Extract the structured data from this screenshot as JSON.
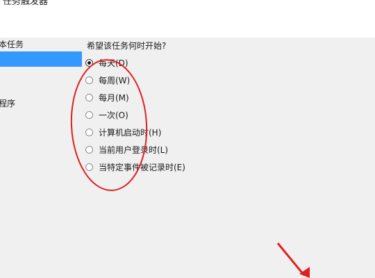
{
  "window": {
    "title": "任务触发器"
  },
  "sidebar": {
    "items": [
      {
        "label": "本任务",
        "selected": false
      },
      {
        "label": "",
        "selected": true
      },
      {
        "label": "程序",
        "selected": false
      }
    ]
  },
  "trigger": {
    "question": "希望该任务何时开始?",
    "options": [
      {
        "label": "每天(D)",
        "checked": true
      },
      {
        "label": "每周(W)",
        "checked": false
      },
      {
        "label": "每月(M)",
        "checked": false
      },
      {
        "label": "一次(O)",
        "checked": false
      },
      {
        "label": "计算机启动时(H)",
        "checked": false
      },
      {
        "label": "当前用户登录时(L)",
        "checked": false
      },
      {
        "label": "当特定事件被记录时(E)",
        "checked": false
      }
    ]
  },
  "annotation": {
    "color": "#e02020"
  }
}
